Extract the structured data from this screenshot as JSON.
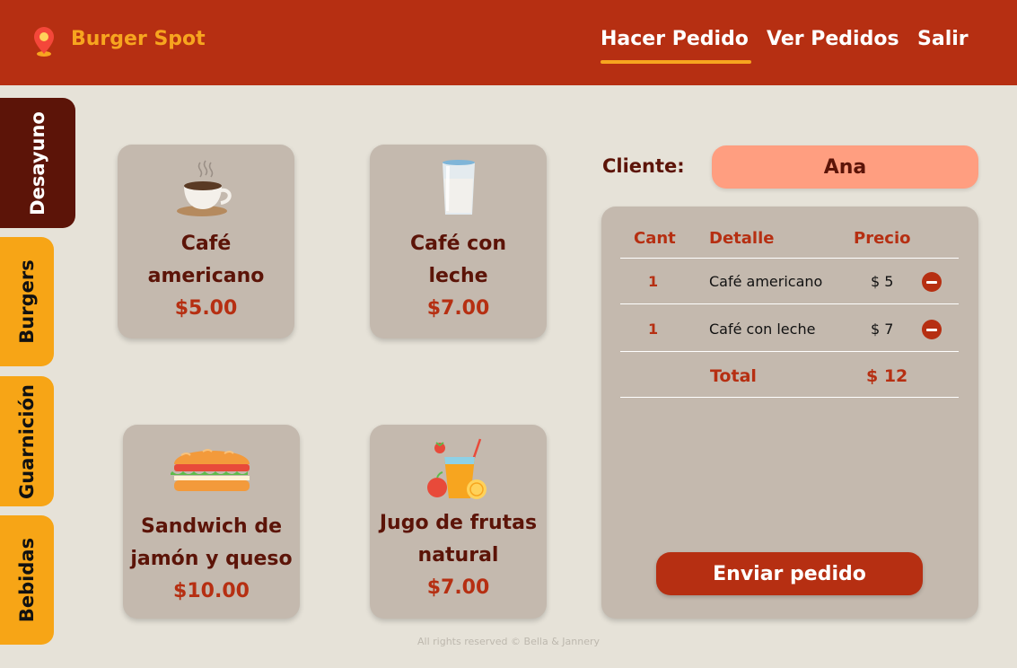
{
  "header": {
    "brand": "Burger Spot",
    "logo_icon": "map-pin-icon",
    "nav": {
      "order": "Hacer Pedido",
      "view_orders": "Ver Pedidos",
      "logout": "Salir"
    },
    "active_nav": "Hacer Pedido"
  },
  "sidebar": {
    "tabs": [
      {
        "label": "Desayuno",
        "active": true
      },
      {
        "label": "Burgers",
        "active": false
      },
      {
        "label": "Guarnición",
        "active": false
      },
      {
        "label": "Bebidas",
        "active": false
      }
    ]
  },
  "menu": {
    "items": [
      {
        "name_line1": "Café",
        "name_line2": "americano",
        "price": "$5.00",
        "icon": "coffee-cup-icon"
      },
      {
        "name_line1": "Café con",
        "name_line2": "leche",
        "price": "$7.00",
        "icon": "milk-glass-icon"
      },
      {
        "name_line1": "Sandwich de",
        "name_line2": "jamón y queso",
        "price": "$10.00",
        "icon": "sandwich-icon"
      },
      {
        "name_line1": "Jugo de frutas",
        "name_line2": "natural",
        "price": "$7.00",
        "icon": "fruit-juice-icon"
      }
    ]
  },
  "order": {
    "client_label": "Cliente:",
    "client_name": "Ana",
    "columns": {
      "qty": "Cant",
      "detail": "Detalle",
      "price": "Precio"
    },
    "rows": [
      {
        "qty": "1",
        "detail": "Café americano",
        "price": "$ 5"
      },
      {
        "qty": "1",
        "detail": "Café con leche",
        "price": "$ 7"
      }
    ],
    "total_label": "Total",
    "total_value": "$ 12",
    "send_label": "Enviar pedido"
  },
  "footer": {
    "text": "All rights reserved © Bella & Jannery"
  },
  "colors": {
    "header": "#b62f12",
    "accent": "#f7a51f",
    "dark": "#5c1408",
    "background": "#e6e2d8",
    "card": "#c4b9ae",
    "client_field": "#ff9e80"
  }
}
